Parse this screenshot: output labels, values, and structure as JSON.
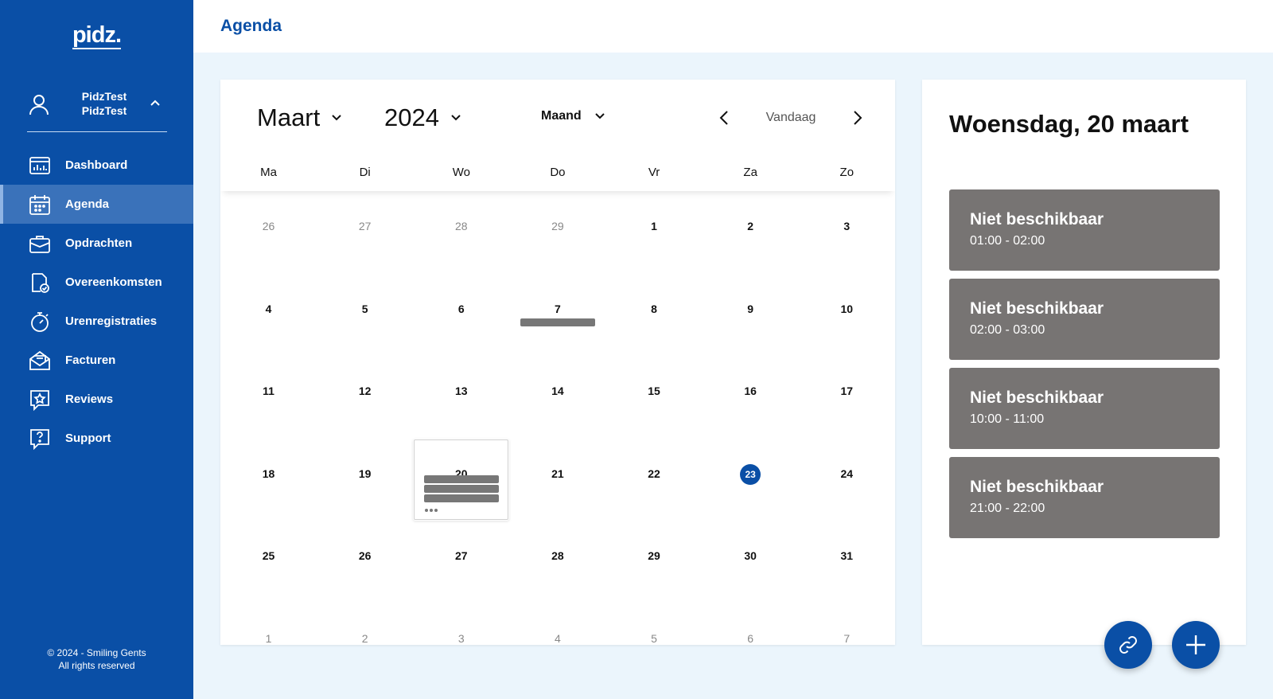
{
  "sidebar": {
    "logo": "pidz.",
    "user": {
      "line1": "PidzTest",
      "line2": "PidzTest"
    },
    "items": [
      {
        "label": "Dashboard",
        "icon": "dashboard-icon"
      },
      {
        "label": "Agenda",
        "icon": "calendar-icon",
        "active": true
      },
      {
        "label": "Opdrachten",
        "icon": "briefcase-icon"
      },
      {
        "label": "Overeenkomsten",
        "icon": "contract-icon"
      },
      {
        "label": "Urenregistraties",
        "icon": "stopwatch-icon"
      },
      {
        "label": "Facturen",
        "icon": "invoice-icon"
      },
      {
        "label": "Reviews",
        "icon": "review-icon"
      },
      {
        "label": "Support",
        "icon": "support-icon"
      }
    ],
    "footer_line1": "© 2024 - Smiling Gents",
    "footer_line2": "All rights reserved"
  },
  "header": {
    "title": "Agenda"
  },
  "calendar": {
    "month": "Maart",
    "year": "2024",
    "view": "Maand",
    "today_label": "Vandaag",
    "weekdays": [
      "Ma",
      "Di",
      "Wo",
      "Do",
      "Vr",
      "Za",
      "Zo"
    ],
    "weeks": [
      [
        "26",
        "27",
        "28",
        "29",
        "1",
        "2",
        "3"
      ],
      [
        "4",
        "5",
        "6",
        "7",
        "8",
        "9",
        "10"
      ],
      [
        "11",
        "12",
        "13",
        "14",
        "15",
        "16",
        "17"
      ],
      [
        "18",
        "19",
        "20",
        "21",
        "22",
        "23",
        "24"
      ],
      [
        "25",
        "26",
        "27",
        "28",
        "29",
        "30",
        "31"
      ],
      [
        "1",
        "2",
        "3",
        "4",
        "5",
        "6",
        "7"
      ]
    ],
    "selected_day": "20",
    "today_day": "23",
    "event_counts": {
      "7": 1,
      "20": 4
    }
  },
  "panel": {
    "date_title": "Woensdag, 20 maart",
    "events": [
      {
        "title": "Niet beschikbaar",
        "time": "01:00 - 02:00"
      },
      {
        "title": "Niet beschikbaar",
        "time": "02:00 - 03:00"
      },
      {
        "title": "Niet beschikbaar",
        "time": "10:00 - 11:00"
      },
      {
        "title": "Niet beschikbaar",
        "time": "21:00 - 22:00"
      }
    ]
  },
  "colors": {
    "brand": "#0a4fa6",
    "event": "#777473",
    "background": "#ebf5fc"
  }
}
